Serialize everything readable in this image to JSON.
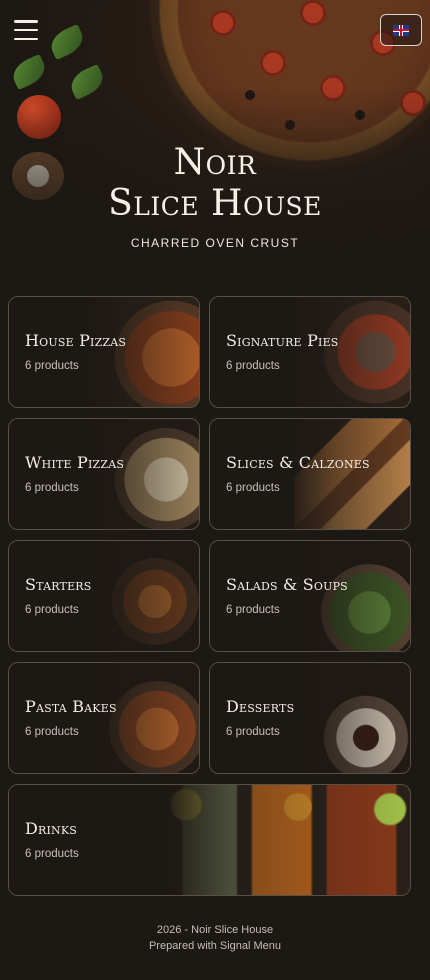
{
  "header": {
    "menu_icon": "hamburger-menu-icon",
    "language_icon": "uk-flag-icon",
    "title_line1": "Noir",
    "title_line2": "Slice House",
    "tagline": "CHARRED OVEN CRUST"
  },
  "categories": [
    {
      "name": "House Pizzas",
      "count": "6 products",
      "image": "pepperoni-pizza"
    },
    {
      "name": "Signature Pies",
      "count": "6 products",
      "image": "signature-pizza"
    },
    {
      "name": "White Pizzas",
      "count": "6 products",
      "image": "white-pizza"
    },
    {
      "name": "Slices & Calzones",
      "count": "6 products",
      "image": "calzone"
    },
    {
      "name": "Starters",
      "count": "6 products",
      "image": "starters-platter"
    },
    {
      "name": "Salads & Soups",
      "count": "6 products",
      "image": "salad-bowl"
    },
    {
      "name": "Pasta Bakes",
      "count": "6 products",
      "image": "pasta-bake"
    },
    {
      "name": "Desserts",
      "count": "6 products",
      "image": "lava-cake"
    },
    {
      "name": "Drinks",
      "count": "6 products",
      "image": "iced-drinks"
    }
  ],
  "footer": {
    "copyright": "2026 - Noir Slice House",
    "credit": "Prepared with Signal Menu"
  }
}
